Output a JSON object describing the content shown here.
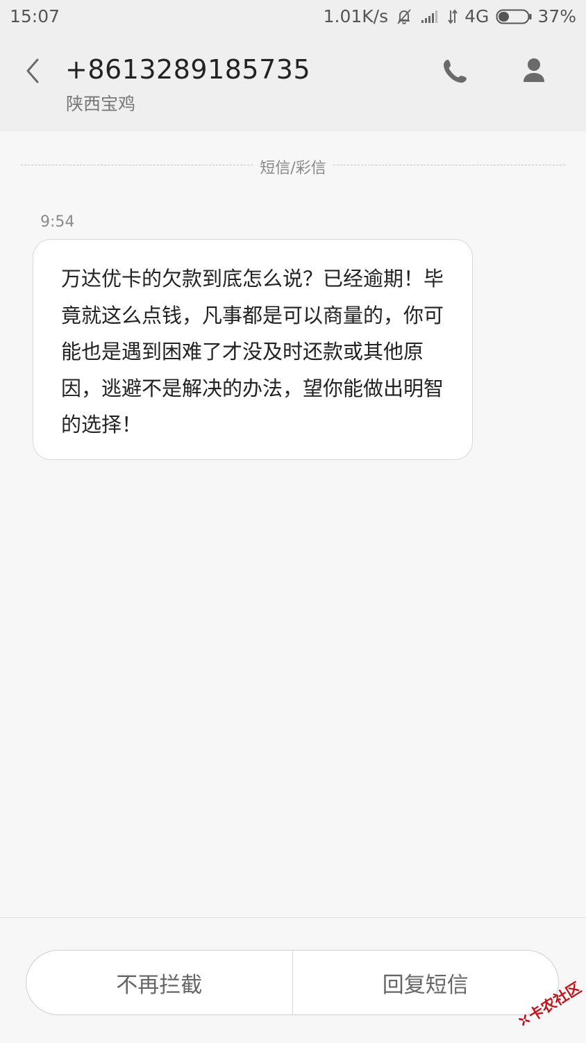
{
  "status_bar": {
    "time": "15:07",
    "net_speed": "1.01K/s",
    "network": "4G",
    "battery": "37%",
    "battery_level": 0.37,
    "icons": [
      "mute-bell-icon",
      "signal-icon",
      "data-arrows-icon",
      "battery-icon"
    ]
  },
  "header": {
    "back_icon": "chevron-left-icon",
    "phone_number": "+8613289185735",
    "location": "陕西宝鸡",
    "call_icon": "phone-icon",
    "contact_icon": "person-icon"
  },
  "thread": {
    "channel_label": "短信/彩信",
    "messages": [
      {
        "time": "9:54",
        "text": "万达优卡的欠款到底怎么说？已经逾期！毕竟就这么点钱，凡事都是可以商量的，你可能也是遇到困难了才没及时还款或其他原因，逃避不是解决的办法，望你能做出明智的选择！"
      }
    ]
  },
  "actions": {
    "unblock_label": "不再拦截",
    "reply_label": "回复短信"
  },
  "watermark": {
    "text": "卡农社区",
    "color": "#c4121a"
  },
  "colors": {
    "header_bg": "#efefef",
    "page_bg": "#f7f7f7",
    "bubble_bg": "#ffffff"
  }
}
